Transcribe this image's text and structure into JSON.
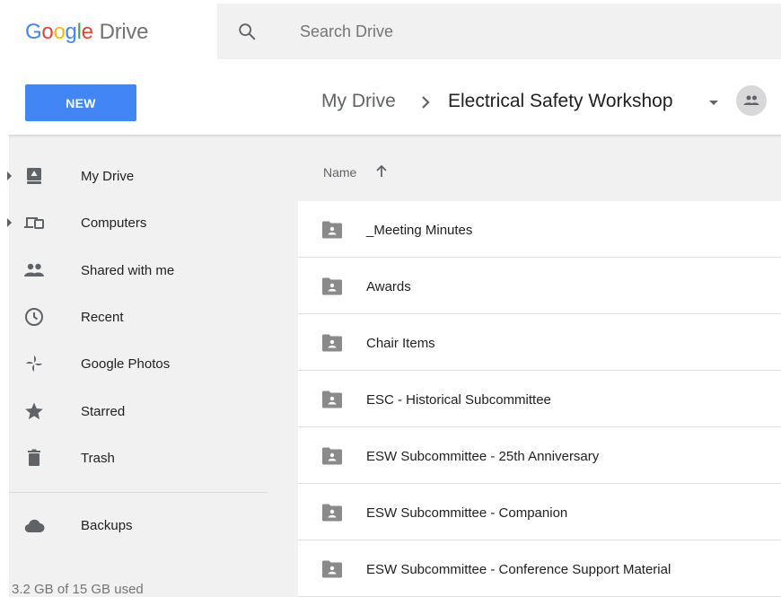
{
  "app": {
    "logo_letters": [
      "G",
      "o",
      "o",
      "g",
      "l",
      "e"
    ],
    "logo_product": "Drive"
  },
  "search": {
    "placeholder": "Search Drive"
  },
  "toolbar": {
    "new_label": "NEW"
  },
  "breadcrumb": {
    "root": "My Drive",
    "current": "Electrical Safety Workshop"
  },
  "sidebar": {
    "items": [
      {
        "label": "My Drive",
        "icon": "my-drive-icon",
        "expandable": true
      },
      {
        "label": "Computers",
        "icon": "computers-icon",
        "expandable": true
      },
      {
        "label": "Shared with me",
        "icon": "shared-with-me-icon",
        "expandable": false
      },
      {
        "label": "Recent",
        "icon": "recent-clock-icon",
        "expandable": false
      },
      {
        "label": "Google Photos",
        "icon": "google-photos-pinwheel-icon",
        "expandable": false
      },
      {
        "label": "Starred",
        "icon": "star-icon",
        "expandable": false
      },
      {
        "label": "Trash",
        "icon": "trash-icon",
        "expandable": false
      }
    ],
    "backups_label": "Backups",
    "storage_text": "3.2 GB of 15 GB used"
  },
  "file_list": {
    "column_name": "Name",
    "sort": "ascending",
    "files": [
      {
        "name": "_Meeting Minutes",
        "type": "shared-folder"
      },
      {
        "name": "Awards",
        "type": "shared-folder"
      },
      {
        "name": "Chair Items",
        "type": "shared-folder"
      },
      {
        "name": "ESC - Historical Subcommittee",
        "type": "shared-folder"
      },
      {
        "name": "ESW Subcommittee - 25th Anniversary",
        "type": "shared-folder"
      },
      {
        "name": "ESW Subcommittee - Companion",
        "type": "shared-folder"
      },
      {
        "name": "ESW Subcommittee - Conference Support Material",
        "type": "shared-folder"
      }
    ]
  },
  "colors": {
    "accent": "#4285f4",
    "sidebar_bg": "#f1f1f1",
    "icon_gray": "#5f6368",
    "folder_gray": "#8a8a8a"
  }
}
